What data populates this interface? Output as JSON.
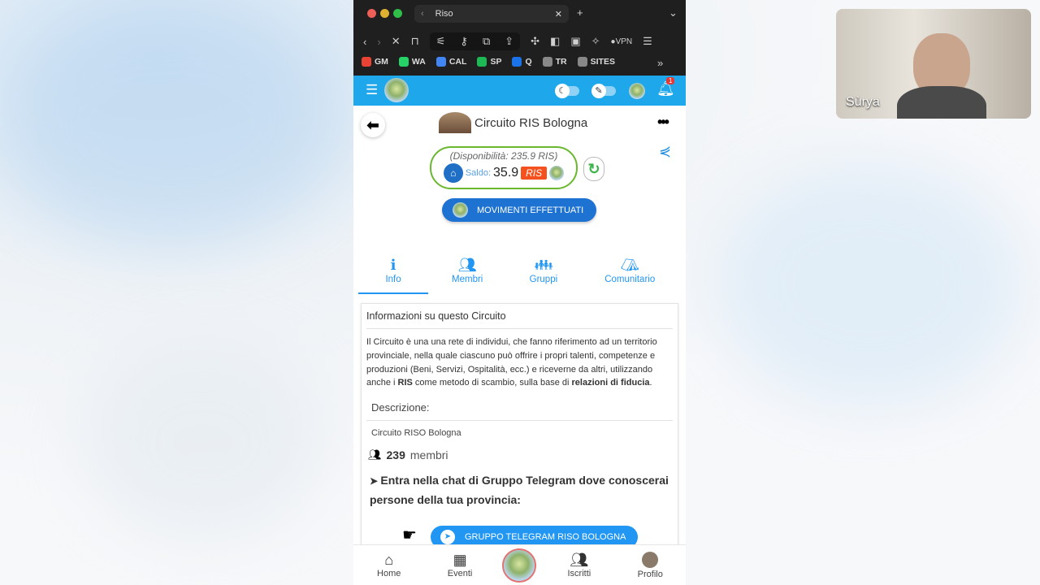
{
  "browser": {
    "tab_title": "Riso",
    "vpn": "VPN",
    "bookmarks": [
      {
        "label": "GM",
        "color": "#ea4335"
      },
      {
        "label": "WA",
        "color": "#25d366"
      },
      {
        "label": "CAL",
        "color": "#4285f4"
      },
      {
        "label": "SP",
        "color": "#1db954"
      },
      {
        "label": "Q",
        "color": "#1a73e8"
      },
      {
        "label": "TR",
        "color": "#888888"
      },
      {
        "label": "SITES",
        "color": "#888888"
      }
    ]
  },
  "appbar": {
    "notification_count": "1",
    "logo_text": "RISO",
    "accent": "#1ea7ea"
  },
  "circuit": {
    "title": "Circuito RIS Bologna",
    "availability": "(Disponibilità: 235.9 RIS)",
    "saldo_label": "Saldo:",
    "saldo_value": "35.9",
    "currency": "RIS",
    "movements_button": "MOVIMENTI EFFETTUATI"
  },
  "tabs": [
    {
      "label": "Info",
      "icon": "info-icon"
    },
    {
      "label": "Membri",
      "icon": "users-icon"
    },
    {
      "label": "Gruppi",
      "icon": "groups-icon"
    },
    {
      "label": "Comunitario",
      "icon": "tent-icon"
    }
  ],
  "info": {
    "heading": "Informazioni su questo Circuito",
    "para_1": "Il Circuito è una una rete di individui, che fanno riferimento ad un territorio provinciale, nella quale ciascuno può offrire i propri talenti, competenze e produzioni (Beni, Servizi, Ospitalità, ecc.) e riceverne da altri, utilizzando anche i ",
    "para_bold_1": "RIS",
    "para_2": " come metodo di scambio, sulla base di ",
    "para_bold_2": "relazioni di fiducia",
    "para_3": ".",
    "descr_label": "Descrizione:",
    "descr_value": "Circuito RISO Bologna",
    "members_count": "239",
    "members_label": "membri",
    "telegram_text": "Entra nella chat di Gruppo Telegram dove conoscerai persone della tua provincia:",
    "telegram_button": "GRUPPO TELEGRAM RISO BOLOGNA"
  },
  "bottom_nav": [
    {
      "label": "Home",
      "icon": "home-icon"
    },
    {
      "label": "Eventi",
      "icon": "calendar-icon"
    },
    {
      "label": "Iscritti",
      "icon": "users-icon"
    },
    {
      "label": "Profilo",
      "icon": "profile-avatar"
    }
  ],
  "webcam": {
    "name": "Sùrya"
  }
}
